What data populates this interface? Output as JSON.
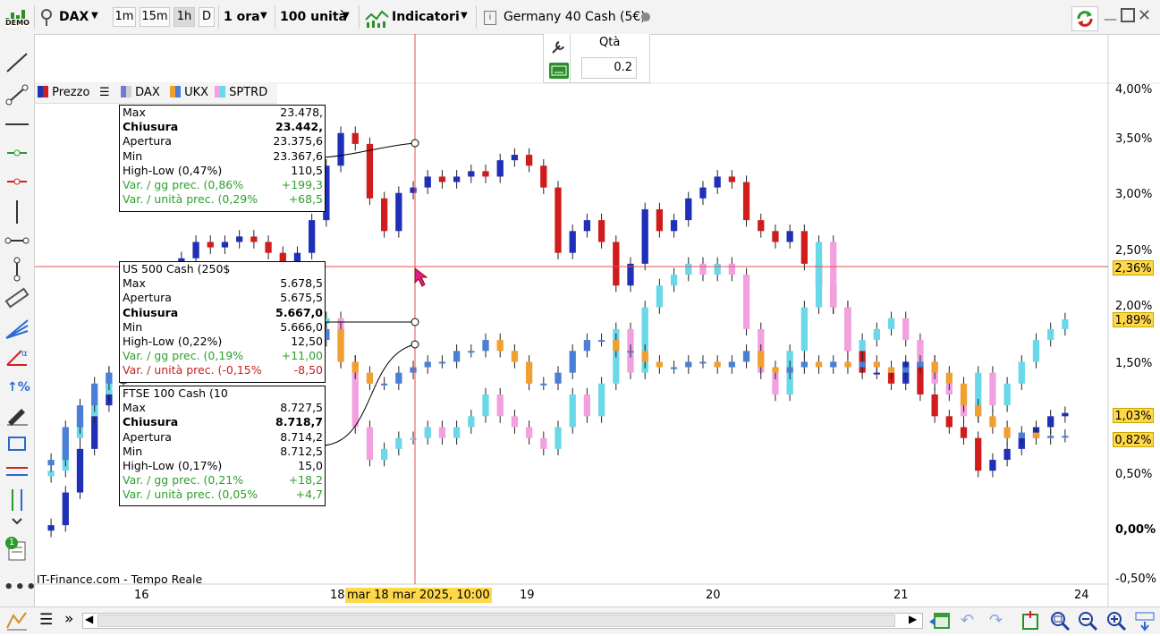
{
  "toolbar": {
    "demo_label": "DEMO",
    "symbol": "DAX",
    "tf_1m": "1m",
    "tf_15m": "15m",
    "tf_1h": "1h",
    "tf_d": "D",
    "interval": "1 ora",
    "quantity": "100 unità",
    "indicators": "Indicatori",
    "instrument": "Germany 40 Cash (5€)"
  },
  "order_panel": {
    "qty_label": "Qtà",
    "qty_value": "0.2"
  },
  "legend": {
    "price": "Prezzo",
    "dax": "DAX",
    "ukx": "UKX",
    "sptrd": "SPTRD"
  },
  "boxes": {
    "dax": {
      "rows": [
        {
          "label": "Max",
          "value": "23.478,"
        },
        {
          "label": "Chiusura",
          "value": "23.442,"
        },
        {
          "label": "Apertura",
          "value": "23.375,6"
        },
        {
          "label": "Min",
          "value": "23.367,6"
        },
        {
          "label": "High-Low (0,47%)",
          "value": "110,5"
        },
        {
          "label": "Var. / gg prec. (0,86%",
          "value": "+199,3"
        },
        {
          "label": "Var. / unità prec. (0,29%",
          "value": "+68,5"
        }
      ]
    },
    "sp": {
      "title": "US 500 Cash (250$",
      "rows": [
        {
          "label": "Max",
          "value": "5.678,5"
        },
        {
          "label": "Apertura",
          "value": "5.675,5"
        },
        {
          "label": "Chiusura",
          "value": "5.667,0"
        },
        {
          "label": "Min",
          "value": "5.666,0"
        },
        {
          "label": "High-Low (0,22%)",
          "value": "12,50"
        },
        {
          "label": "Var. / gg prec. (0,19%",
          "value": "+11,00"
        },
        {
          "label": "Var. / unità prec. (-0,15%",
          "value": "-8,50"
        }
      ]
    },
    "ftse": {
      "title": "FTSE 100 Cash (10",
      "rows": [
        {
          "label": "Max",
          "value": "8.727,5"
        },
        {
          "label": "Chiusura",
          "value": "8.718,7"
        },
        {
          "label": "Apertura",
          "value": "8.714,2"
        },
        {
          "label": "Min",
          "value": "8.712,5"
        },
        {
          "label": "High-Low (0,17%)",
          "value": "15,0"
        },
        {
          "label": "Var. / gg prec. (0,21%",
          "value": "+18,2"
        },
        {
          "label": "Var. / unità prec. (0,05%",
          "value": "+4,7"
        }
      ]
    }
  },
  "y_axis": [
    "4,00%",
    "3,50%",
    "3,00%",
    "2,50%",
    "2,00%",
    "1,50%",
    "0,50%",
    "0,00%",
    "-0,50%"
  ],
  "badges": {
    "crosshair": "2,36%",
    "sptrd": "1,89%",
    "dax": "1,03%",
    "ukx": "0,82%"
  },
  "x_axis": [
    "16",
    "18",
    "19",
    "20",
    "21",
    "24"
  ],
  "crosshair_date": "mar 18 mar 2025, 10:00",
  "source": "IT-Finance.com - Tempo Reale",
  "notification_count": "1",
  "colors": {
    "dax_up": "#1f2fb8",
    "dax_down": "#d01c1c",
    "sp_up": "#69d8e8",
    "sp_down": "#f2a0e0",
    "ukx_up": "#4a7fd6",
    "ukx_down": "#f0a030",
    "crosshair": "#e05050",
    "badge_bg": "#ffd84a"
  },
  "chart_data": {
    "type": "candlestick",
    "y_unit": "%",
    "ylim": [
      -0.5,
      4.0
    ],
    "series": [
      {
        "name": "DAX",
        "values": [
          0.0,
          0.3,
          0.7,
          1.1,
          1.3,
          1.6,
          1.8,
          2.0,
          2.3,
          2.45,
          2.6,
          2.55,
          2.6,
          2.65,
          2.6,
          2.5,
          2.4,
          2.5,
          2.8,
          3.3,
          3.6,
          3.5,
          3.0,
          2.7,
          3.05,
          3.1,
          3.2,
          3.15,
          3.2,
          3.25,
          3.2,
          3.35,
          3.4,
          3.3,
          3.1,
          2.5,
          2.7,
          2.8,
          2.6,
          2.2,
          2.4,
          2.9,
          2.7,
          2.8,
          3.0,
          3.1,
          3.2,
          3.15,
          2.8,
          2.7,
          2.6,
          2.7,
          2.4,
          2.2,
          2.0,
          1.6,
          1.4,
          1.4,
          1.3,
          1.5,
          1.2,
          1.0,
          0.9,
          0.8,
          0.5,
          0.6,
          0.7,
          0.8,
          0.9,
          1.0,
          1.03
        ]
      },
      {
        "name": "SPTRD",
        "values": [
          0.5,
          0.8,
          1.0,
          1.2,
          1.4,
          1.5,
          1.7,
          1.9,
          2.0,
          2.1,
          1.9,
          1.7,
          1.6,
          1.6,
          1.5,
          1.55,
          1.6,
          1.7,
          1.85,
          1.9,
          1.5,
          0.9,
          0.6,
          0.7,
          0.8,
          0.8,
          0.9,
          0.8,
          0.9,
          1.0,
          1.2,
          1.0,
          0.9,
          0.8,
          0.7,
          0.9,
          1.2,
          1.0,
          1.3,
          1.8,
          1.4,
          2.0,
          2.2,
          2.3,
          2.4,
          2.3,
          2.4,
          2.3,
          1.8,
          1.4,
          1.2,
          1.6,
          2.0,
          2.6,
          2.0,
          1.6,
          1.7,
          1.8,
          1.9,
          1.7,
          1.5,
          1.3,
          1.2,
          1.0,
          1.4,
          1.1,
          1.3,
          1.5,
          1.7,
          1.8,
          1.89
        ]
      },
      {
        "name": "UKX",
        "values": [
          0.6,
          0.9,
          1.1,
          1.3,
          1.4,
          1.5,
          1.45,
          1.5,
          1.5,
          1.45,
          1.5,
          1.45,
          1.5,
          1.5,
          1.55,
          1.6,
          1.7,
          1.75,
          1.7,
          1.8,
          1.5,
          1.4,
          1.3,
          1.3,
          1.4,
          1.45,
          1.5,
          1.5,
          1.6,
          1.6,
          1.7,
          1.6,
          1.5,
          1.3,
          1.3,
          1.4,
          1.6,
          1.7,
          1.7,
          1.6,
          1.6,
          1.5,
          1.45,
          1.45,
          1.5,
          1.5,
          1.45,
          1.5,
          1.6,
          1.45,
          1.4,
          1.45,
          1.5,
          1.45,
          1.5,
          1.45,
          1.5,
          1.45,
          1.4,
          1.45,
          1.5,
          1.4,
          1.3,
          1.1,
          1.0,
          0.9,
          0.8,
          0.85,
          0.8,
          0.82,
          0.82
        ]
      }
    ],
    "x_ticks": [
      "16",
      "18",
      "19",
      "20",
      "21",
      "24"
    ]
  }
}
